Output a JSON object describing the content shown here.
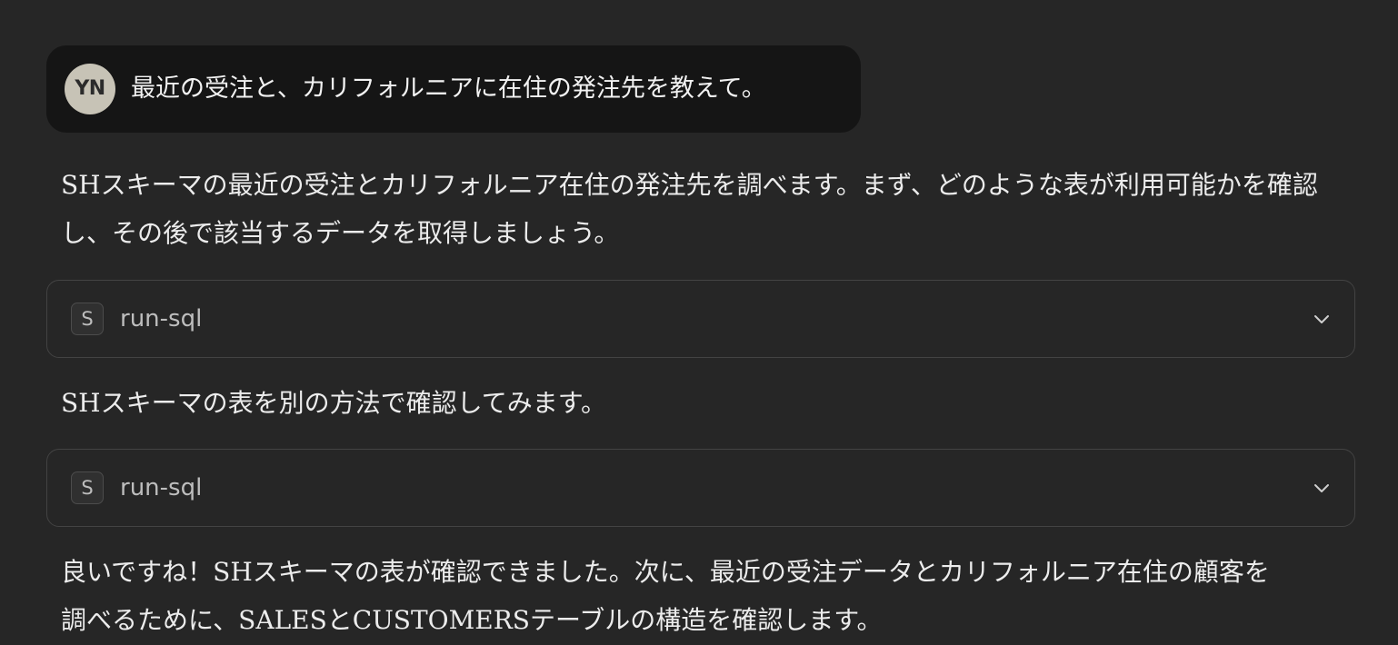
{
  "user_message": {
    "avatar_initials": "YN",
    "text": "最近の受注と、カリフォルニアに在住の発注先を教えて。"
  },
  "messages": [
    {
      "type": "text",
      "text": "SHスキーマの最近の受注とカリフォルニア在住の発注先を調べます。まず、どのような表が利用可能かを確認し、その後で該当するデータを取得しましょう。"
    },
    {
      "type": "tool",
      "badge": "S",
      "name": "run-sql",
      "icon": "chevron-down-icon"
    },
    {
      "type": "text",
      "text": "SHスキーマの表を別の方法で確認してみます。"
    },
    {
      "type": "tool",
      "badge": "S",
      "name": "run-sql",
      "icon": "chevron-down-icon"
    },
    {
      "type": "text",
      "text": "良いですね！SHスキーマの表が確認できました。次に、最近の受注データとカリフォルニア在住の顧客を調べるために、SALESとCUSTOMERSテーブルの構造を確認します。"
    }
  ],
  "colors": {
    "background": "#262626",
    "user_bubble": "#151515",
    "avatar": "#c7c3b6",
    "text": "#ececec",
    "tool_border": "#434343"
  }
}
